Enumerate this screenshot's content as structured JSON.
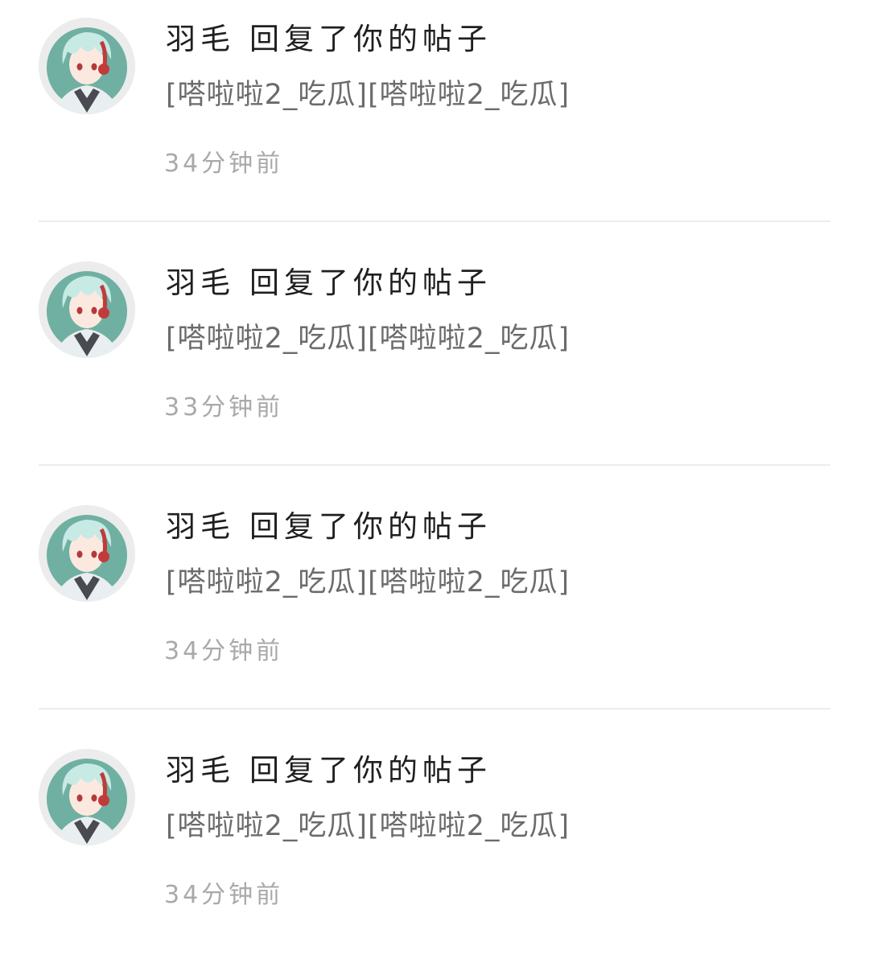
{
  "notifications": [
    {
      "user": "羽毛",
      "action": "回复了你的帖子",
      "content": "[嗒啦啦2_吃瓜][嗒啦啦2_吃瓜]",
      "time": "34分钟前",
      "avatar_icon": "anime-avatar-icon"
    },
    {
      "user": "羽毛",
      "action": "回复了你的帖子",
      "content": "[嗒啦啦2_吃瓜][嗒啦啦2_吃瓜]",
      "time": "33分钟前",
      "avatar_icon": "anime-avatar-icon"
    },
    {
      "user": "羽毛",
      "action": "回复了你的帖子",
      "content": "[嗒啦啦2_吃瓜][嗒啦啦2_吃瓜]",
      "time": "34分钟前",
      "avatar_icon": "anime-avatar-icon"
    },
    {
      "user": "羽毛",
      "action": "回复了你的帖子",
      "content": "[嗒啦啦2_吃瓜][嗒啦啦2_吃瓜]",
      "time": "34分钟前",
      "avatar_icon": "anime-avatar-icon"
    }
  ],
  "colors": {
    "background": "#ffffff",
    "title_text": "#1f1f1f",
    "content_text": "#6b6b6b",
    "time_text": "#a9a9a9",
    "divider": "#ededed",
    "avatar_bg": "#6fb0a2"
  }
}
